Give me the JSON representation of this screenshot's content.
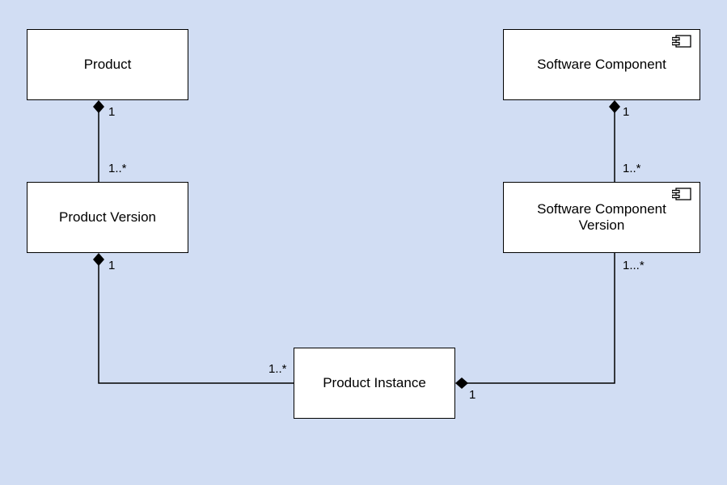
{
  "boxes": {
    "product": {
      "label": "Product"
    },
    "productVersion": {
      "label": "Product Version"
    },
    "softwareComponent": {
      "label": "Software Component"
    },
    "softwareComponentVersion": {
      "label": "Software Component\nVersion"
    },
    "productInstance": {
      "label": "Product Instance"
    }
  },
  "multiplicities": {
    "product_bottom": "1",
    "productVersion_top": "1..*",
    "productVersion_bottom": "1",
    "softwareComponent_bottom": "1",
    "softwareComponentVersion_top": "1..*",
    "softwareComponentVersion_bottom": "1...*",
    "productInstance_left": "1..*",
    "productInstance_right": "1"
  }
}
